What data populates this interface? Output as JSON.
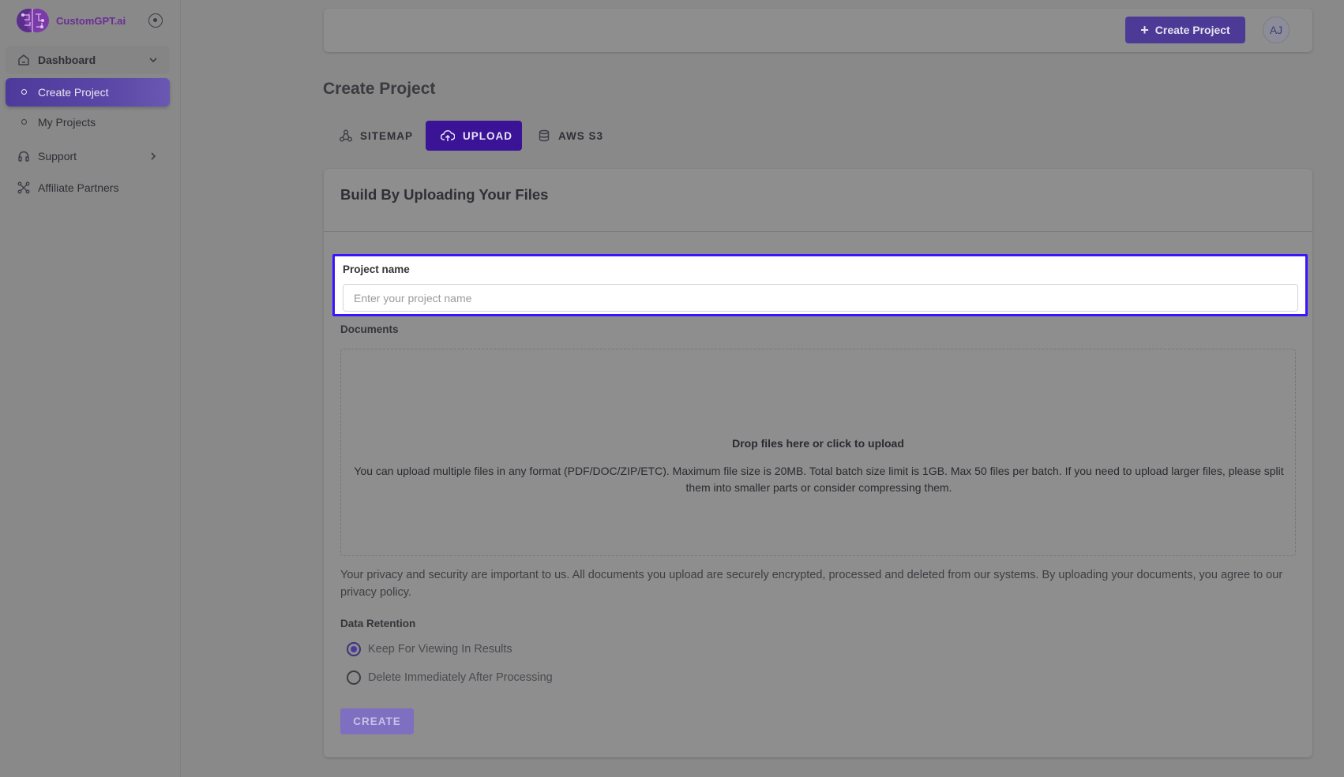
{
  "brand": {
    "name": "CustomGPT.ai"
  },
  "sidebar": {
    "group": {
      "label": "Dashboard"
    },
    "items": [
      {
        "label": "Create Project",
        "active": true
      },
      {
        "label": "My Projects",
        "active": false
      },
      {
        "label": "Support",
        "active": false
      },
      {
        "label": "Affiliate Partners",
        "active": false
      }
    ]
  },
  "header": {
    "create_button": "Create Project",
    "avatar_initials": "AJ"
  },
  "page": {
    "title": "Create Project"
  },
  "tabs": [
    {
      "label": "SITEMAP",
      "icon": "sitemap-icon",
      "active": false
    },
    {
      "label": "UPLOAD",
      "icon": "cloud-upload-icon",
      "active": true
    },
    {
      "label": "AWS S3",
      "icon": "database-icon",
      "active": false
    }
  ],
  "form": {
    "title": "Build By Uploading Your Files",
    "project_name_label": "Project name",
    "project_name_placeholder": "Enter your project name",
    "project_name_value": "",
    "documents_label": "Documents",
    "dropzone_title": "Drop files here or click to upload",
    "dropzone_desc": "You can upload multiple files in any format (PDF/DOC/ZIP/ETC). Maximum file size is 20MB. Total batch size limit is 1GB. Max 50 files per batch. If you need to upload larger files, please split them into smaller parts or consider compressing them.",
    "privacy_note": "Your privacy and security are important to us. All documents you upload are securely encrypted, processed and deleted from our systems. By uploading your documents, you agree to our privacy policy.",
    "retention_label": "Data Retention",
    "retention_options": [
      {
        "label": "Keep For Viewing In Results",
        "checked": true
      },
      {
        "label": "Delete Immediately After Processing",
        "checked": false
      }
    ],
    "submit_label": "CREATE"
  },
  "colors": {
    "accent": "#3b1396",
    "active_nav": "#4e3a9a",
    "highlight_border": "#3b14ff",
    "brand_text": "#6b2d95"
  }
}
